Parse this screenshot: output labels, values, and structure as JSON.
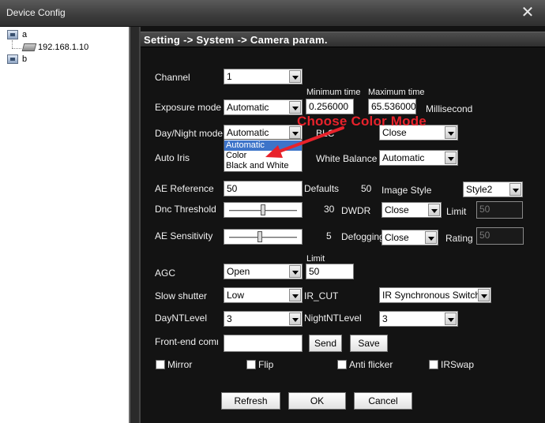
{
  "window": {
    "title": "Device Config",
    "close_glyph": "✕"
  },
  "tree": {
    "root_a": "a",
    "device": "192.168.1.10",
    "root_b": "b"
  },
  "header": {
    "breadcrumb": "Setting -> System -> Camera param."
  },
  "fields": {
    "channel": {
      "label": "Channel",
      "value": "1"
    },
    "exposure": {
      "label": "Exposure mode",
      "value": "Automatic"
    },
    "min_time": {
      "label": "Minimum time",
      "value": "0.256000"
    },
    "max_time": {
      "label": "Maximum time",
      "value": "65.536000"
    },
    "time_unit": "Millisecond",
    "day_night": {
      "label": "Day/Night mode",
      "value": "Automatic",
      "options": [
        "Automatic",
        "Color",
        "Black and White"
      ]
    },
    "blc": {
      "label": "BLC",
      "value": "Close"
    },
    "auto_iris": {
      "label": "Auto Iris"
    },
    "white_balance": {
      "label": "White Balance",
      "value": "Automatic"
    },
    "ae_reference": {
      "label": "AE Reference",
      "value": "50",
      "defaults_label": "Defaults",
      "defaults_value": "50"
    },
    "image_style": {
      "label": "Image Style",
      "value": "Style2"
    },
    "dnc_threshold": {
      "label": "Dnc Threshold",
      "value": "30",
      "level": 0.5
    },
    "dwdr": {
      "label": "DWDR",
      "value": "Close",
      "limit_label": "Limit",
      "limit_value": "50"
    },
    "ae_sensitivity": {
      "label": "AE Sensitivity",
      "value": "5",
      "level": 0.45
    },
    "defogging": {
      "label": "Defogging",
      "value": "Close",
      "rating_label": "Rating",
      "rating_value": "50"
    },
    "agc": {
      "label": "AGC",
      "value": "Open",
      "limit_label": "Limit",
      "limit_value": "50"
    },
    "slow_shutter": {
      "label": "Slow shutter",
      "value": "Low"
    },
    "ir_cut": {
      "label": "IR_CUT",
      "value": "IR Synchronous Switch"
    },
    "day_nt_level": {
      "label": "DayNTLevel",
      "value": "3"
    },
    "night_nt_level": {
      "label": "NightNTLevel",
      "value": "3"
    },
    "front_end": {
      "label": "Front-end comma",
      "value": "",
      "send": "Send",
      "save": "Save"
    }
  },
  "checkboxes": {
    "mirror": "Mirror",
    "flip": "Flip",
    "anti_flicker": "Anti flicker",
    "irswap": "IRSwap"
  },
  "buttons": {
    "refresh": "Refresh",
    "ok": "OK",
    "cancel": "Cancel"
  },
  "annotation": {
    "text": "Choose Color Mode",
    "color": "#e8222b"
  },
  "colors": {
    "selection": "#3d74c9",
    "panel_bg": "#131313"
  }
}
